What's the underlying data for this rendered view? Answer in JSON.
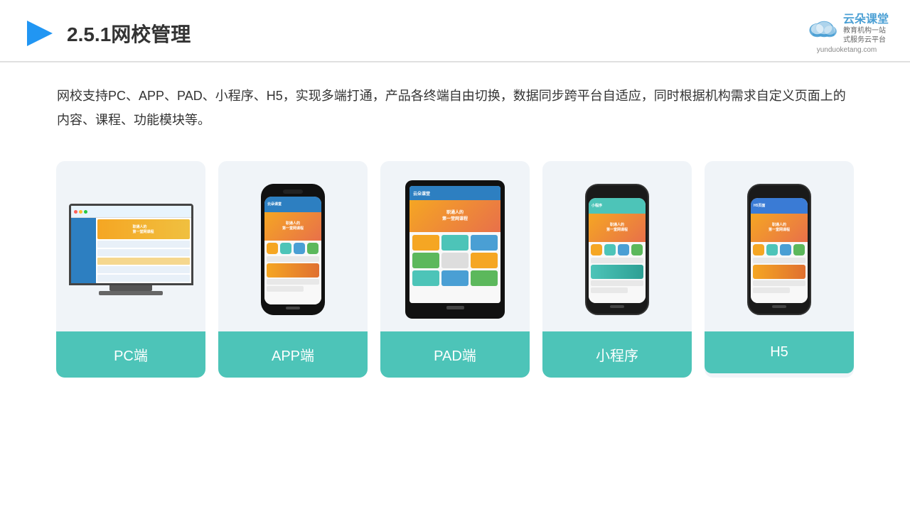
{
  "header": {
    "title": "2.5.1网校管理",
    "brand": {
      "name": "云朵课堂",
      "slogan_line1": "教育机构一站",
      "slogan_line2": "式服务云平台",
      "url": "yunduoketang.com"
    }
  },
  "description": {
    "text": "网校支持PC、APP、PAD、小程序、H5，实现多端打通，产品各终端自由切换，数据同步跨平台自适应，同时根据机构需求自定义页面上的内容、课程、功能模块等。"
  },
  "cards": [
    {
      "id": "pc",
      "label": "PC端"
    },
    {
      "id": "app",
      "label": "APP端"
    },
    {
      "id": "pad",
      "label": "PAD端"
    },
    {
      "id": "miniprogram",
      "label": "小程序"
    },
    {
      "id": "h5",
      "label": "H5"
    }
  ],
  "colors": {
    "accent": "#4dc4b8",
    "primary_blue": "#2d7fc1",
    "orange": "#f5a623",
    "header_border": "#e0e0e0"
  }
}
